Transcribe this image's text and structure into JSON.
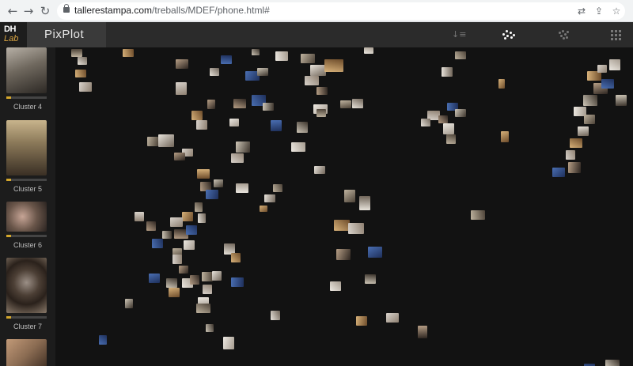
{
  "browser": {
    "back_icon": "arrow-left-icon",
    "forward_icon": "arrow-right-icon",
    "reload_icon": "reload-icon",
    "url_domain": "tallerestampa.com",
    "url_path": "/treballs/MDEF/phone.html#"
  },
  "app": {
    "logo_top": "DH",
    "logo_bottom": "Lab",
    "title": "PixPlot",
    "header_icons": [
      "sort-icon",
      "scatter-layout-icon",
      "umap-layout-icon",
      "grid-layout-icon"
    ]
  },
  "sidebar": {
    "clusters": [
      {
        "label": "Cluster 4",
        "color": "#8d8579"
      },
      {
        "label": "Cluster 5",
        "color": "#9b8a6a"
      },
      {
        "label": "Cluster 6",
        "color": "#6b5a4e"
      },
      {
        "label": "Cluster 7",
        "color": "#5b4a3b"
      },
      {
        "label": "",
        "color": "#8a6b52"
      }
    ]
  },
  "colors": {
    "accent": "#d4a72c",
    "canvas_bg": "#121212",
    "header_bg": "#2b2b2b"
  }
}
